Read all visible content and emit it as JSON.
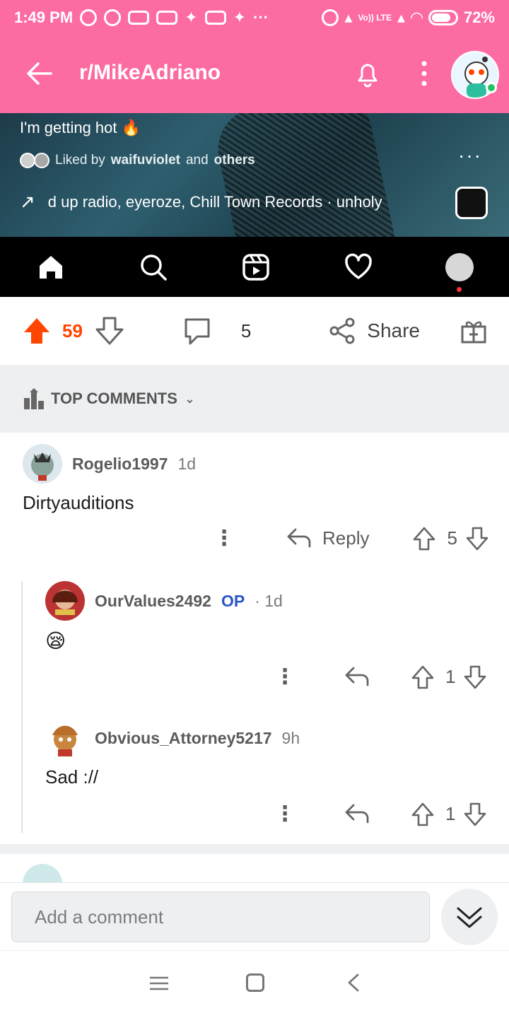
{
  "status": {
    "time": "1:49 PM",
    "battery": "72%",
    "net": "Vo)) LTE"
  },
  "header": {
    "title": "r/MikeAdriano"
  },
  "media": {
    "caption": "I'm getting hot",
    "caption_emoji": "🔥",
    "liked_prefix": "Liked by",
    "liked_user": "waifuviolet",
    "liked_and": "and",
    "liked_others": "others",
    "music": "d up radio, eyeroze, Chill Town Records · unholy",
    "more": "···"
  },
  "post_actions": {
    "score": "59",
    "comments": "5",
    "share": "Share"
  },
  "sort": {
    "label": "TOP COMMENTS"
  },
  "comments": [
    {
      "user": "Rogelio1997",
      "time": "1d",
      "body": "Dirtyauditions",
      "votes": "5",
      "reply": "Reply"
    },
    {
      "user": "OurValues2492",
      "op": "OP",
      "time": "· 1d",
      "body": "😪",
      "votes": "1"
    },
    {
      "user": "Obvious_Attorney5217",
      "time": "9h",
      "body": "Sad ://",
      "votes": "1"
    }
  ],
  "composer": {
    "placeholder": "Add a comment"
  },
  "colors": {
    "brand_pink": "#fd6ba3",
    "upvote": "#ff4500",
    "op": "#2a56c6"
  }
}
